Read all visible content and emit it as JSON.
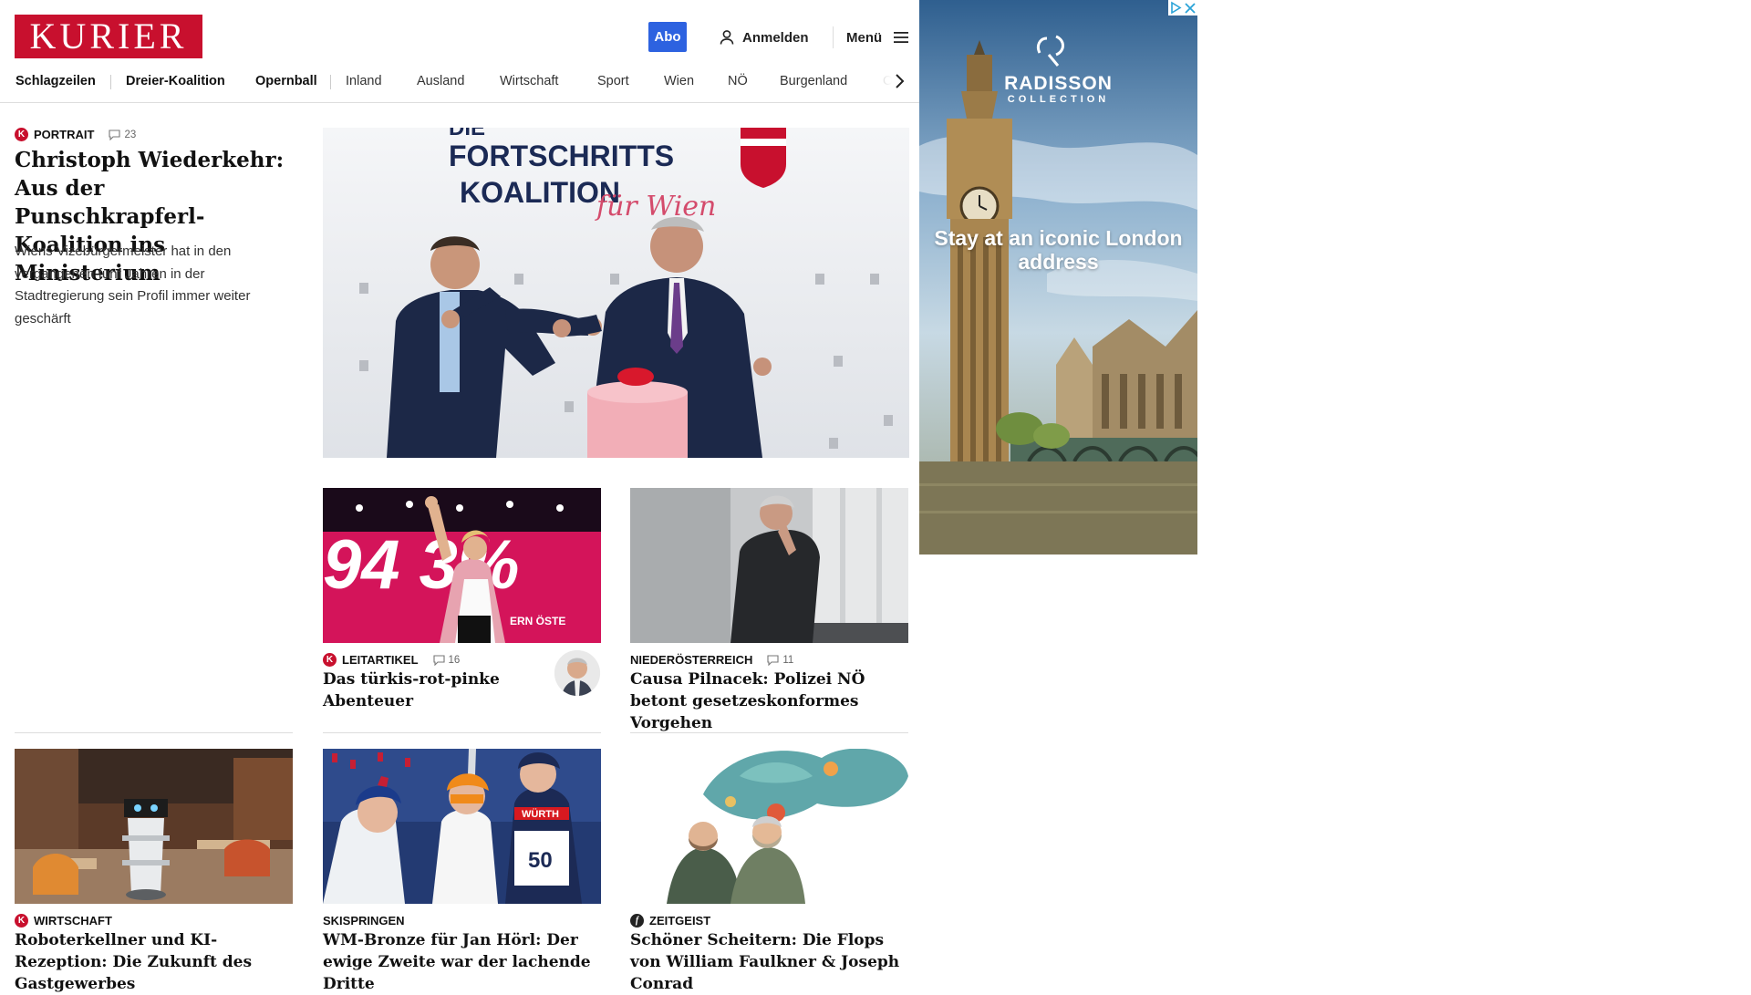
{
  "header": {
    "logo": "KURIER",
    "abo_label": "Abo",
    "login_label": "Anmelden",
    "menu_label": "Menü"
  },
  "nav": {
    "items": [
      "Schlagzeilen",
      "Dreier-Koalition",
      "Opernball",
      "Inland",
      "Ausland",
      "Wirtschaft",
      "Sport",
      "Wien",
      "NÖ",
      "Burgenland",
      "Oö"
    ]
  },
  "lead": {
    "kicker": "PORTRAIT",
    "comments": "23",
    "headline": "Christoph Wiederkehr: Aus der Punschkrapferl-Koalition ins Ministerium",
    "teaser": "Wiens Vizebürgermeister hat in den vergangenen fünf Jahren in der Stadtregierung sein Profil immer weiter geschärft",
    "image_banner_line1": "DIE",
    "image_banner_line2": "FORTSCHRITTS",
    "image_banner_line3": "KOALITION",
    "image_banner_script": "für Wien"
  },
  "articles": [
    {
      "kicker": "LEITARTIKEL",
      "comments": "16",
      "headline": "Das türkis-rot-pinke Abenteuer",
      "image_text": "94 3%",
      "image_text2": "ERN ÖSTE"
    },
    {
      "kicker": "NIEDERÖSTERREICH",
      "comments": "11",
      "headline": "Causa Pilnacek: Polizei NÖ betont gesetzeskonformes Vorgehen"
    },
    {
      "kicker": "WIRTSCHAFT",
      "headline": "Roboterkellner und KI-Rezeption: Die Zukunft des Gastgewerbes"
    },
    {
      "kicker": "SKISPRINGEN",
      "headline": "WM-Bronze für Jan Hörl: Der ewige Zweite war der lachende Dritte",
      "image_bib": "50",
      "image_sponsor": "WÜRTH"
    },
    {
      "kicker": "ZEITGEIST",
      "headline": "Schöner Scheitern: Die Flops von William Faulkner & Joseph Conrad"
    }
  ],
  "ad": {
    "brand": "RADISSON",
    "brand_sub": "COLLECTION",
    "copy": "Stay at an iconic London address"
  },
  "colors": {
    "brand_red": "#c8102e",
    "abo_blue": "#2d62e0"
  }
}
